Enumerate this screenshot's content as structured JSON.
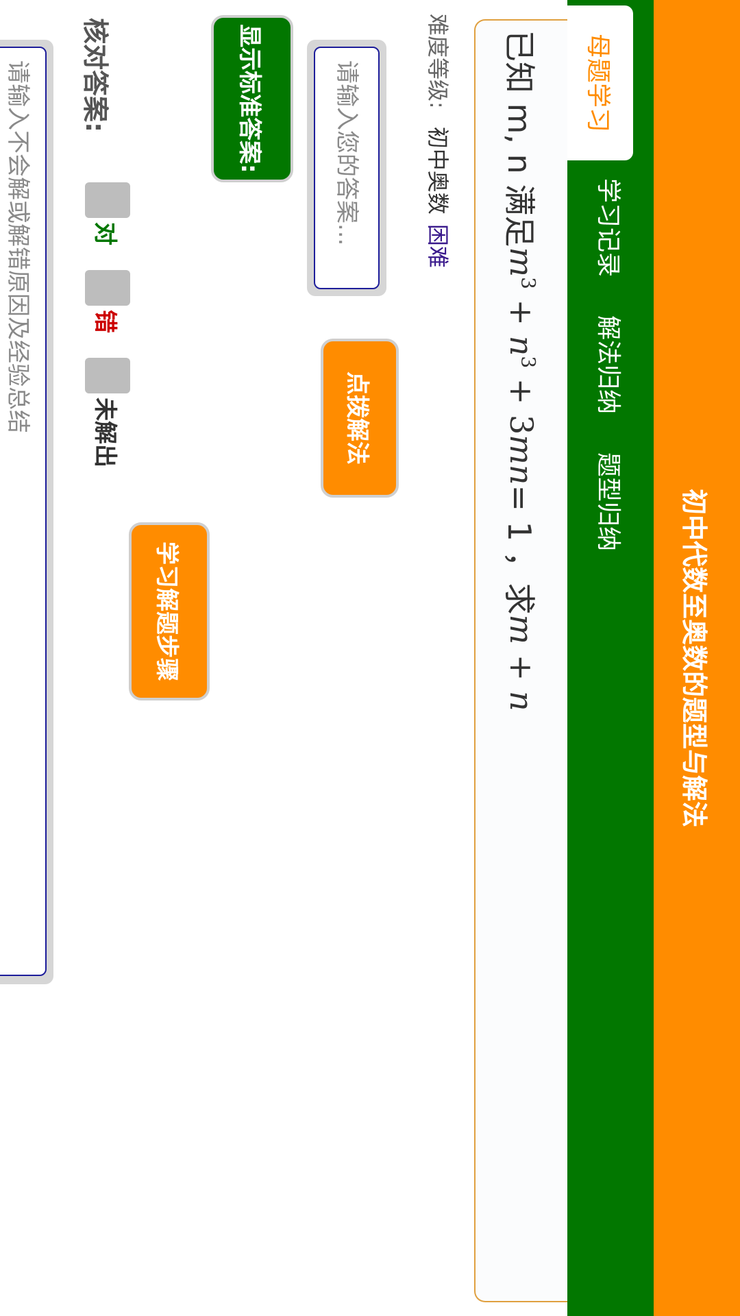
{
  "header": {
    "title": "初中代数至奥数的题型与解法"
  },
  "tabs": [
    {
      "label": "母题学习",
      "active": true
    },
    {
      "label": "学习记录",
      "active": false
    },
    {
      "label": "解法归纳",
      "active": false
    },
    {
      "label": "题型归纳",
      "active": false
    }
  ],
  "question": {
    "prefix": "已知 m, n 满足 ",
    "var_m": "m",
    "exp_3a": "3",
    "plus1": " + ",
    "var_n": "n",
    "exp_3b": "3",
    "plus2": " + 3",
    "term_mn": "mn",
    "equals": " = 1 ，求",
    "ask": "m + n"
  },
  "difficulty": {
    "label": "难度等级:",
    "level": "初中奥数",
    "rating": "困难"
  },
  "answer": {
    "placeholder": "请输入您的答案..."
  },
  "buttons": {
    "hint": "点拨解法",
    "show_answer": "显示标准答案:",
    "steps": "学习解题步骤"
  },
  "check": {
    "label": "核对答案:",
    "right": "对",
    "wrong": "错",
    "unsolved": "未解出"
  },
  "reason": {
    "placeholder": "请输入不会解或解错原因及经验总结"
  },
  "colors": {
    "orange": "#ff8c00",
    "green": "#027700",
    "input_border": "#1d1d9a"
  }
}
